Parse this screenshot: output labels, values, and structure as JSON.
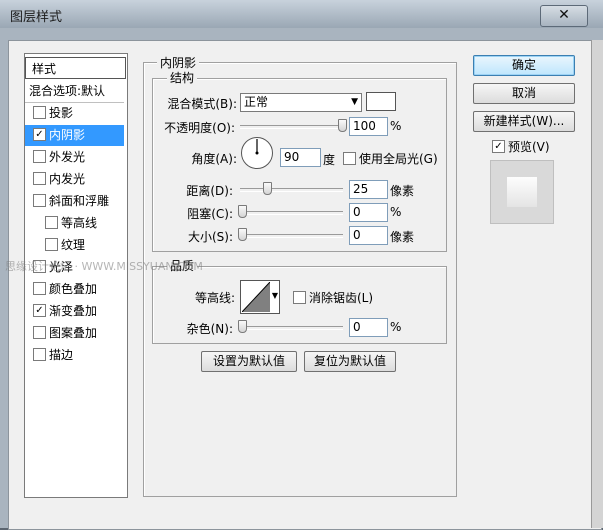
{
  "window": {
    "title": "图层样式",
    "close_glyph": "✕"
  },
  "styles_panel": {
    "header": "样式",
    "items": [
      {
        "label": "混合选项:默认",
        "checkbox": false,
        "checked": false,
        "selected": false,
        "indent": false
      },
      {
        "label": "投影",
        "checkbox": true,
        "checked": false,
        "selected": false,
        "indent": false
      },
      {
        "label": "内阴影",
        "checkbox": true,
        "checked": true,
        "selected": true,
        "indent": false
      },
      {
        "label": "外发光",
        "checkbox": true,
        "checked": false,
        "selected": false,
        "indent": false
      },
      {
        "label": "内发光",
        "checkbox": true,
        "checked": false,
        "selected": false,
        "indent": false
      },
      {
        "label": "斜面和浮雕",
        "checkbox": true,
        "checked": false,
        "selected": false,
        "indent": false
      },
      {
        "label": "等高线",
        "checkbox": true,
        "checked": false,
        "selected": false,
        "indent": true
      },
      {
        "label": "纹理",
        "checkbox": true,
        "checked": false,
        "selected": false,
        "indent": true
      },
      {
        "label": "光泽",
        "checkbox": true,
        "checked": false,
        "selected": false,
        "indent": false
      },
      {
        "label": "颜色叠加",
        "checkbox": true,
        "checked": false,
        "selected": false,
        "indent": false
      },
      {
        "label": "渐变叠加",
        "checkbox": true,
        "checked": true,
        "selected": false,
        "indent": false
      },
      {
        "label": "图案叠加",
        "checkbox": true,
        "checked": false,
        "selected": false,
        "indent": false
      },
      {
        "label": "描边",
        "checkbox": true,
        "checked": false,
        "selected": false,
        "indent": false
      }
    ]
  },
  "inner_shadow": {
    "title": "内阴影",
    "structure": {
      "title": "结构",
      "blend_mode_label": "混合模式(B):",
      "blend_mode_value": "正常",
      "opacity_label": "不透明度(O):",
      "opacity_value": "100",
      "opacity_unit": "%",
      "opacity_level": 1.0,
      "angle_label": "角度(A):",
      "angle_value": "90",
      "angle_unit": "度",
      "global_light_label": "使用全局光(G)",
      "global_light_checked": false,
      "distance_label": "距离(D):",
      "distance_value": "25",
      "distance_unit": "像素",
      "distance_level": 0.25,
      "choke_label": "阻塞(C):",
      "choke_value": "0",
      "choke_unit": "%",
      "choke_level": 0,
      "size_label": "大小(S):",
      "size_value": "0",
      "size_unit": "像素",
      "size_level": 0
    },
    "quality": {
      "title": "品质",
      "contour_label": "等高线:",
      "antialias_label": "消除锯齿(L)",
      "antialias_checked": false,
      "noise_label": "杂色(N):",
      "noise_value": "0",
      "noise_unit": "%",
      "noise_level": 0
    },
    "make_default_label": "设置为默认值",
    "reset_default_label": "复位为默认值"
  },
  "right_panel": {
    "ok_label": "确定",
    "cancel_label": "取消",
    "new_style_label": "新建样式(W)...",
    "preview_label": "预览(V)",
    "preview_checked": true
  },
  "watermark": {
    "text": "思缘设计论坛 · WWW.MISSYUAN.COM"
  }
}
